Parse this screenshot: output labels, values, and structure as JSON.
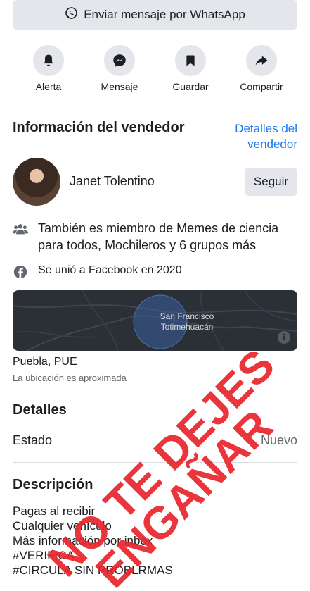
{
  "whatsapp_button": {
    "label": "Enviar mensaje por WhatsApp",
    "icon": "whatsapp-icon"
  },
  "actions": [
    {
      "label": "Alerta",
      "icon": "bell-icon"
    },
    {
      "label": "Mensaje",
      "icon": "messenger-icon"
    },
    {
      "label": "Guardar",
      "icon": "bookmark-icon"
    },
    {
      "label": "Compartir",
      "icon": "share-icon"
    }
  ],
  "seller": {
    "section_title": "Información del vendedor",
    "details_link": "Detalles del vendedor",
    "name": "Janet Tolentino",
    "follow_label": "Seguir",
    "groups_text": "También es miembro de Memes de ciencia para todos, Mochileros y 6 grupos más",
    "joined_text": "Se unió a Facebook en 2020"
  },
  "map": {
    "label": "San Francisco Totimehuacán",
    "info_icon": "i"
  },
  "location": {
    "city": "Puebla, PUE",
    "note": "La ubicación es aproximada"
  },
  "details": {
    "title": "Detalles",
    "condition_label": "Estado",
    "condition_value": "Nuevo"
  },
  "description": {
    "title": "Descripción",
    "lines": [
      "Pagas al recibir",
      "Cualquier vehículo",
      "Más información por inbox",
      "#VERIFICA",
      "#CIRCULA SIN PROBLRMAS"
    ]
  },
  "overlay_stamp": {
    "line1": "NO TE DEJES",
    "line2": "ENGAÑAR",
    "color": "#e8242b"
  },
  "colors": {
    "accent": "#1877f2",
    "button_bg": "#e4e6eb",
    "secondary_text": "#65676b"
  }
}
